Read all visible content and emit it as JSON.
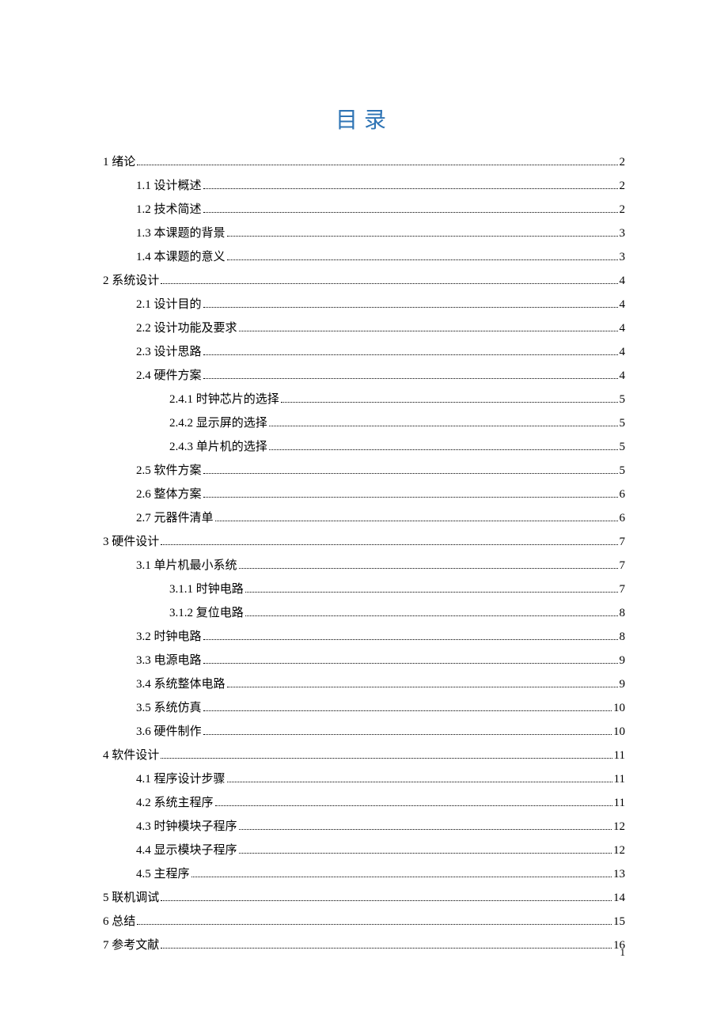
{
  "title": "目录",
  "page_number": "1",
  "toc": [
    {
      "level": 1,
      "label": "1 绪论",
      "page": "2"
    },
    {
      "level": 2,
      "label": "1.1 设计概述",
      "page": "2"
    },
    {
      "level": 2,
      "label": "1.2 技术简述",
      "page": "2"
    },
    {
      "level": 2,
      "label": "1.3 本课题的背景",
      "page": "3"
    },
    {
      "level": 2,
      "label": "1.4 本课题的意义",
      "page": "3"
    },
    {
      "level": 1,
      "label": "2 系统设计",
      "page": "4"
    },
    {
      "level": 2,
      "label": "2.1 设计目的",
      "page": "4"
    },
    {
      "level": 2,
      "label": "2.2 设计功能及要求",
      "page": "4"
    },
    {
      "level": 2,
      "label": "2.3 设计思路",
      "page": "4"
    },
    {
      "level": 2,
      "label": "2.4 硬件方案",
      "page": "4"
    },
    {
      "level": 3,
      "label": "2.4.1 时钟芯片的选择",
      "page": "5"
    },
    {
      "level": 3,
      "label": "2.4.2 显示屏的选择",
      "page": "5"
    },
    {
      "level": 3,
      "label": "2.4.3 单片机的选择",
      "page": "5"
    },
    {
      "level": 2,
      "label": "2.5 软件方案",
      "page": "5"
    },
    {
      "level": 2,
      "label": "2.6 整体方案",
      "page": "6"
    },
    {
      "level": 2,
      "label": "2.7 元器件清单",
      "page": "6"
    },
    {
      "level": 1,
      "label": "3 硬件设计",
      "page": "7"
    },
    {
      "level": 2,
      "label": "3.1 单片机最小系统",
      "page": "7"
    },
    {
      "level": 3,
      "label": "3.1.1 时钟电路",
      "page": "7"
    },
    {
      "level": 3,
      "label": "3.1.2 复位电路",
      "page": "8"
    },
    {
      "level": 2,
      "label": "3.2 时钟电路",
      "page": "8"
    },
    {
      "level": 2,
      "label": "3.3 电源电路",
      "page": "9"
    },
    {
      "level": 2,
      "label": "3.4 系统整体电路",
      "page": "9"
    },
    {
      "level": 2,
      "label": "3.5 系统仿真",
      "page": "10"
    },
    {
      "level": 2,
      "label": "3.6 硬件制作",
      "page": "10"
    },
    {
      "level": 1,
      "label": "4 软件设计",
      "page": "11"
    },
    {
      "level": 2,
      "label": "4.1 程序设计步骤",
      "page": "11"
    },
    {
      "level": 2,
      "label": "4.2 系统主程序",
      "page": "11"
    },
    {
      "level": 2,
      "label": "4.3 时钟模块子程序",
      "page": "12"
    },
    {
      "level": 2,
      "label": "4.4 显示模块子程序",
      "page": "12"
    },
    {
      "level": 2,
      "label": "4.5 主程序",
      "page": "13"
    },
    {
      "level": 1,
      "label": "5 联机调试",
      "page": "14"
    },
    {
      "level": 1,
      "label": "6 总结",
      "page": "15"
    },
    {
      "level": 1,
      "label": "7 参考文献",
      "page": "16"
    }
  ]
}
